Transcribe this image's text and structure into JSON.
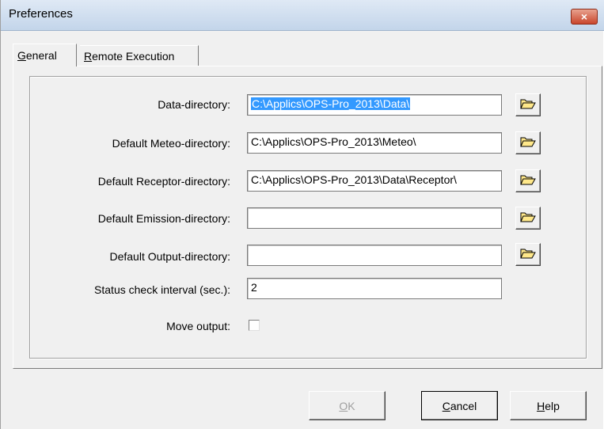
{
  "window": {
    "title": "Preferences",
    "close_label": "×"
  },
  "tabs": [
    {
      "label_prefix": "",
      "label_mnemonic": "G",
      "label_rest": "eneral",
      "selected": true
    },
    {
      "label_prefix": "",
      "label_mnemonic": "R",
      "label_rest": "emote Execution",
      "selected": false
    }
  ],
  "form": {
    "data_directory": {
      "label": "Data-directory:",
      "value": "C:\\Applics\\OPS-Pro_2013\\Data\\",
      "selected": true
    },
    "meteo_directory": {
      "label": "Default Meteo-directory:",
      "value": "C:\\Applics\\OPS-Pro_2013\\Meteo\\"
    },
    "receptor_directory": {
      "label": "Default Receptor-directory:",
      "value": "C:\\Applics\\OPS-Pro_2013\\Data\\Receptor\\"
    },
    "emission_directory": {
      "label": "Default Emission-directory:",
      "value": ""
    },
    "output_directory": {
      "label": "Default Output-directory:",
      "value": ""
    },
    "status_interval": {
      "label": "Status check interval (sec.):",
      "value": "2"
    },
    "move_output": {
      "label": "Move output:",
      "checked": false
    }
  },
  "buttons": {
    "ok": {
      "mnemonic": "O",
      "rest": "K",
      "enabled": false
    },
    "cancel": {
      "mnemonic": "C",
      "rest": "ancel",
      "enabled": true
    },
    "help": {
      "mnemonic": "H",
      "rest": "elp",
      "enabled": true
    }
  },
  "icons": {
    "folder": "open-folder-icon"
  },
  "colors": {
    "selection": "#3399ff",
    "folder_fill": "#ffe88a",
    "close_button": "#c9462c"
  }
}
